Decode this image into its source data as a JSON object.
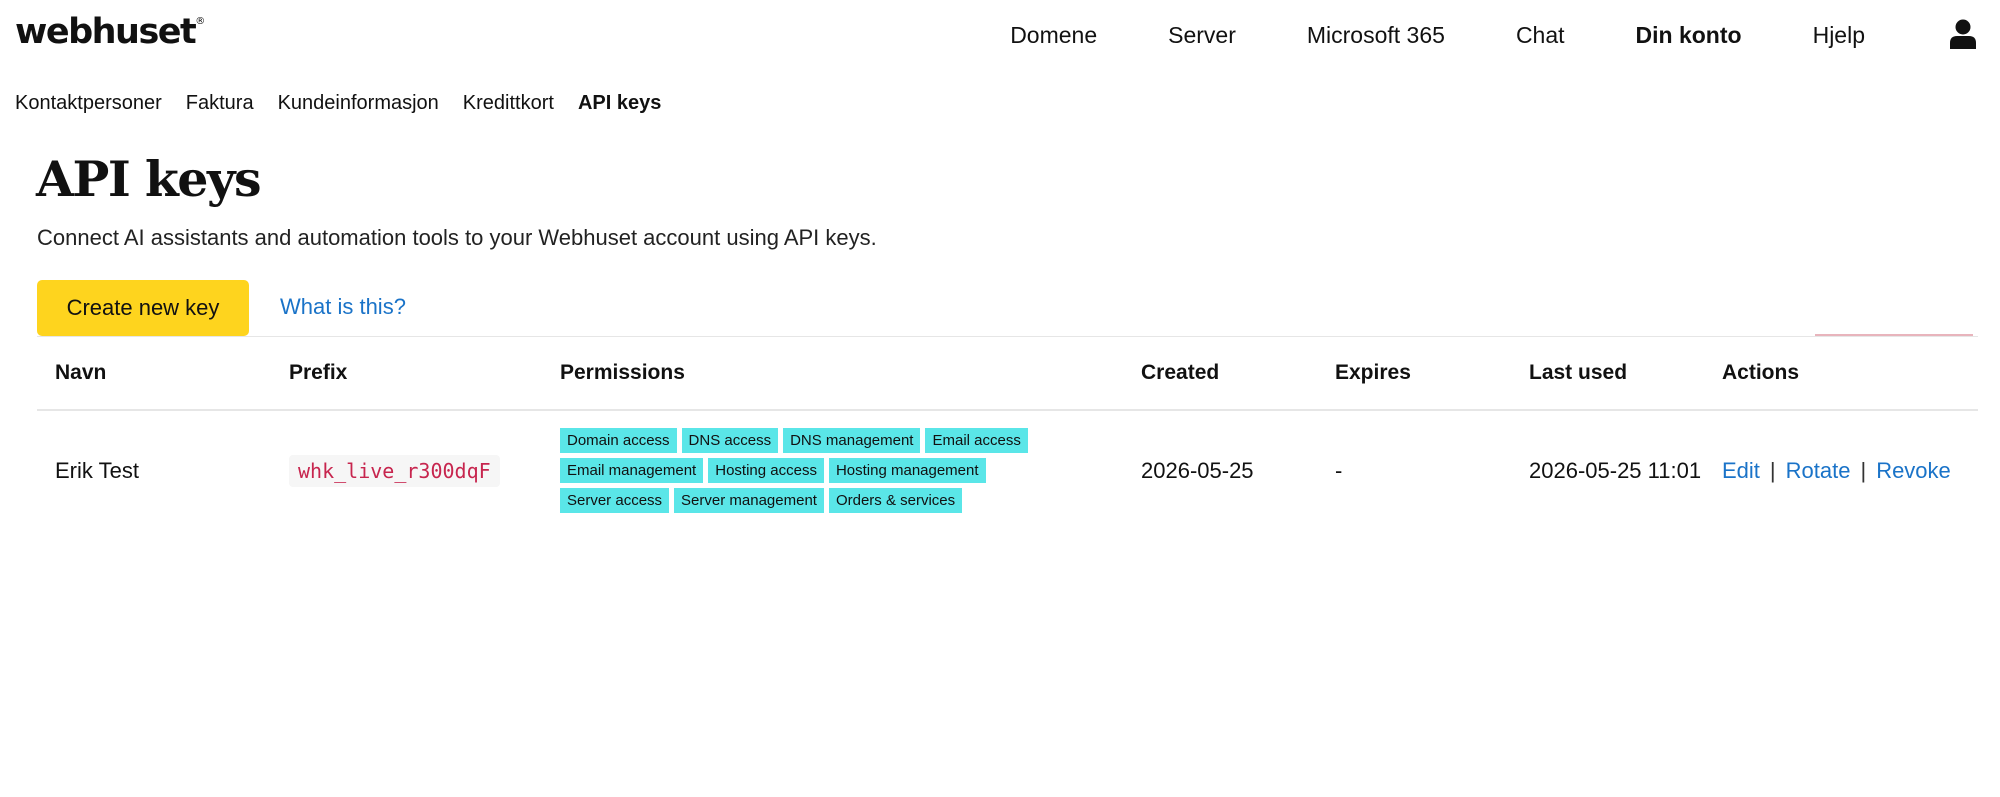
{
  "logo": {
    "text": "webhuset",
    "mark": "®"
  },
  "main_nav": [
    {
      "label": "Domene",
      "active": false
    },
    {
      "label": "Server",
      "active": false
    },
    {
      "label": "Microsoft 365",
      "active": false
    },
    {
      "label": "Chat",
      "active": false
    },
    {
      "label": "Din konto",
      "active": true
    },
    {
      "label": "Hjelp",
      "active": false
    }
  ],
  "user_icon": "user-icon",
  "sub_nav": [
    {
      "label": "Kontaktpersoner",
      "active": false
    },
    {
      "label": "Faktura",
      "active": false
    },
    {
      "label": "Kundeinformasjon",
      "active": false
    },
    {
      "label": "Kredittkort",
      "active": false
    },
    {
      "label": "API keys",
      "active": true
    }
  ],
  "page": {
    "title": "API keys",
    "description": "Connect AI assistants and automation tools to your Webhuset account using API keys.",
    "create_button": "Create new key",
    "help_link": "What is this?"
  },
  "colors": {
    "accent_yellow": "#fed41e",
    "badge_cyan": "#5ae6e8",
    "link_blue": "#1a73c8",
    "code_red": "#c7254e"
  },
  "table": {
    "headers": {
      "name": "Navn",
      "prefix": "Prefix",
      "permissions": "Permissions",
      "created": "Created",
      "expires": "Expires",
      "last_used": "Last used",
      "actions": "Actions"
    },
    "rows": [
      {
        "name": "Erik Test",
        "prefix": "whk_live_r300dqF",
        "permissions": [
          "Domain access",
          "DNS access",
          "DNS management",
          "Email access",
          "Email management",
          "Hosting access",
          "Hosting management",
          "Server access",
          "Server management",
          "Orders & services"
        ],
        "created": "2026-05-25",
        "expires": "-",
        "last_used": "2026-05-25 11:01",
        "actions": {
          "edit": "Edit",
          "rotate": "Rotate",
          "revoke": "Revoke",
          "separator": "|"
        }
      }
    ]
  }
}
